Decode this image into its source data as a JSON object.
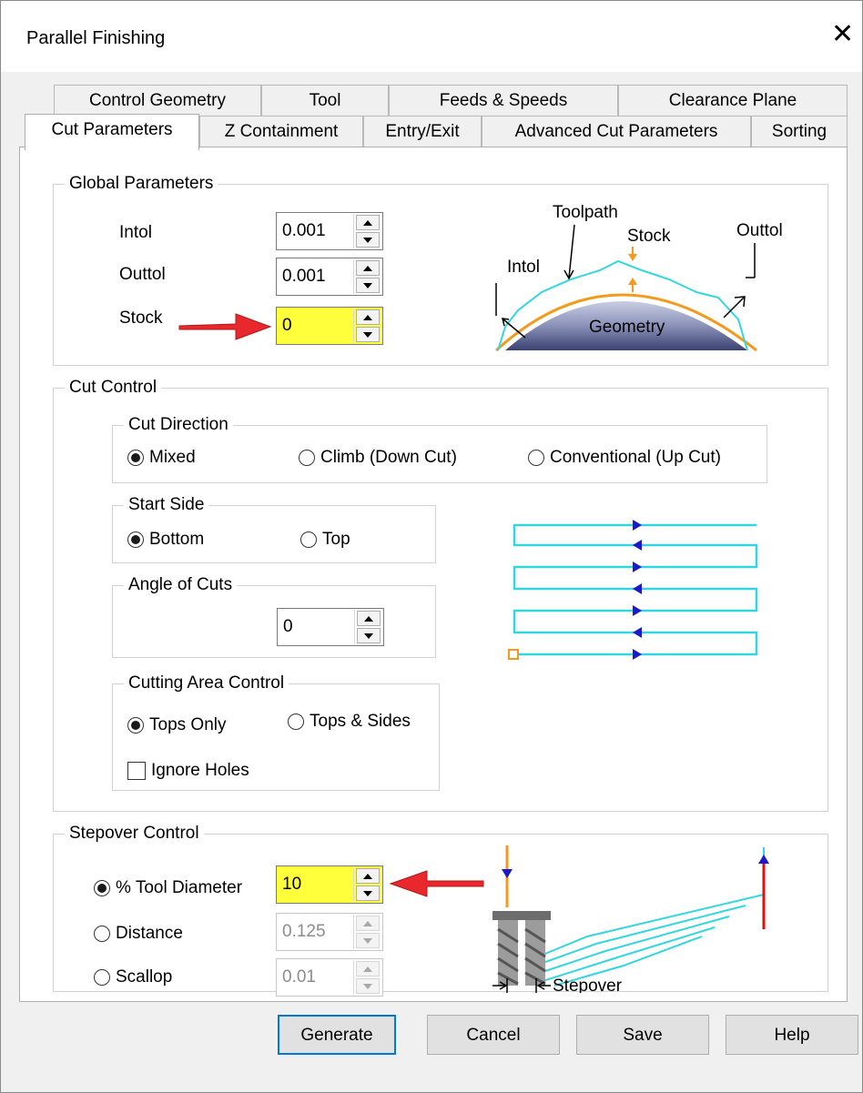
{
  "window": {
    "title": "Parallel Finishing"
  },
  "tabs": {
    "row1": [
      "Control Geometry",
      "Tool",
      "Feeds & Speeds",
      "Clearance Plane"
    ],
    "row2": [
      "Cut Parameters",
      "Z Containment",
      "Entry/Exit",
      "Advanced Cut Parameters",
      "Sorting"
    ],
    "active": "Cut Parameters"
  },
  "global_parameters": {
    "legend": "Global Parameters",
    "intol": {
      "label": "Intol",
      "value": "0.001"
    },
    "outtol": {
      "label": "Outtol",
      "value": "0.001"
    },
    "stock": {
      "label": "Stock",
      "value": "0",
      "highlight_color": "#FFFF3C"
    },
    "diagram": {
      "toolpath": "Toolpath",
      "stock": "Stock",
      "outtol": "Outtol",
      "intol": "Intol",
      "geometry": "Geometry"
    }
  },
  "cut_control": {
    "legend": "Cut Control",
    "cut_direction": {
      "legend": "Cut Direction",
      "options": [
        "Mixed",
        "Climb (Down Cut)",
        "Conventional (Up Cut)"
      ],
      "selected": "Mixed"
    },
    "start_side": {
      "legend": "Start Side",
      "options": [
        "Bottom",
        "Top"
      ],
      "selected": "Bottom"
    },
    "angle_of_cuts": {
      "legend": "Angle of Cuts",
      "value": "0"
    },
    "cutting_area_control": {
      "legend": "Cutting Area Control",
      "options": [
        "Tops Only",
        "Tops & Sides"
      ],
      "selected": "Tops Only",
      "ignore_holes": {
        "label": "Ignore Holes",
        "checked": false
      }
    }
  },
  "stepover_control": {
    "legend": "Stepover Control",
    "tool_diameter": {
      "label": "% Tool Diameter",
      "value": "10",
      "selected": true
    },
    "distance": {
      "label": "Distance",
      "value": "0.125",
      "enabled": false
    },
    "scallop": {
      "label": "Scallop",
      "value": "0.01",
      "enabled": false
    },
    "diagram_label": "Stepover"
  },
  "buttons": {
    "generate": "Generate",
    "cancel": "Cancel",
    "save": "Save",
    "help": "Help"
  },
  "colors": {
    "accent": "#0078D7",
    "highlight": "#FFFF3C",
    "arrow": "#E8282C",
    "toolpath": "#33D6E0"
  }
}
